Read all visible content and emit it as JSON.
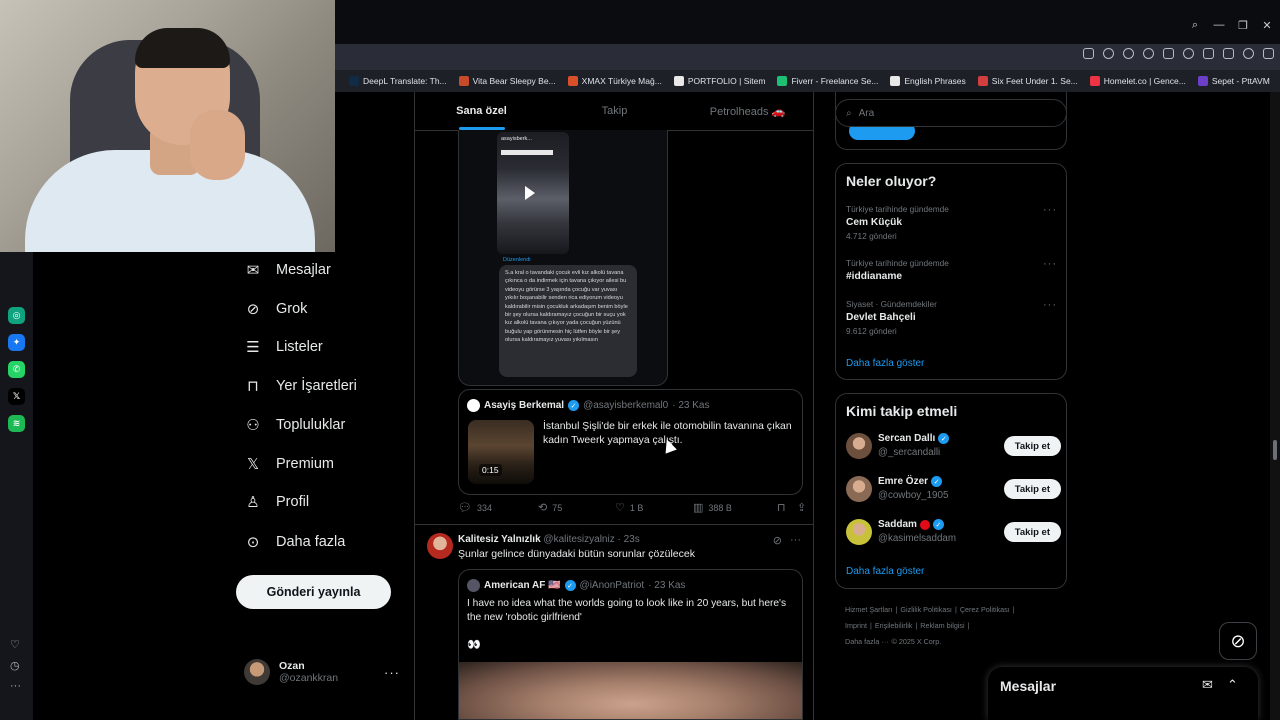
{
  "browser": {
    "bookmarks": [
      {
        "label": "DeepL Translate: Th...",
        "color": "#0f2b46"
      },
      {
        "label": "Vita Bear Sleepy Be...",
        "color": "#c74b2a"
      },
      {
        "label": "XMAX Türkiye Mağ...",
        "color": "#d8502a"
      },
      {
        "label": "PORTFOLIO | Sitem",
        "color": "#e8e8e8"
      },
      {
        "label": "Fiverr - Freelance Se...",
        "color": "#1dbf73"
      },
      {
        "label": "English Phrases",
        "color": "#e8e8e8"
      },
      {
        "label": "Six Feet Under 1. Se...",
        "color": "#d33f3f"
      },
      {
        "label": "Homelet.co | Gence...",
        "color": "#e34"
      },
      {
        "label": "Sepet - PttAVM",
        "color": "#6b3fc8"
      }
    ]
  },
  "appbar": {
    "apps": [
      {
        "name": "chatgpt-app-icon",
        "glyph": "◎",
        "color": "#10a37f"
      },
      {
        "name": "messenger-app-icon",
        "glyph": "✦",
        "color": "#1877f2"
      },
      {
        "name": "whatsapp-app-icon",
        "glyph": "✆",
        "color": "#25d366"
      },
      {
        "name": "x-app-icon",
        "glyph": "𝕏",
        "color": "#000000"
      },
      {
        "name": "spotify-app-icon",
        "glyph": "≋",
        "color": "#1db954"
      }
    ]
  },
  "nav": {
    "items": [
      {
        "label": "Mesajlar",
        "icon": "envelope-icon",
        "glyph": "✉"
      },
      {
        "label": "Grok",
        "icon": "grok-icon",
        "glyph": "⊘"
      },
      {
        "label": "Listeler",
        "icon": "list-icon",
        "glyph": "☰"
      },
      {
        "label": "Yer İşaretleri",
        "icon": "bookmark-icon",
        "glyph": "⊓"
      },
      {
        "label": "Topluluklar",
        "icon": "communities-icon",
        "glyph": "⚇"
      },
      {
        "label": "Premium",
        "icon": "x-logo-icon",
        "glyph": "𝕏"
      },
      {
        "label": "Profil",
        "icon": "profile-icon",
        "glyph": "♙"
      },
      {
        "label": "Daha fazla",
        "icon": "more-circle-icon",
        "glyph": "⊙"
      }
    ],
    "post_button": "Gönderi yayınla",
    "profile": {
      "name": "Ozan",
      "handle": "@ozankkran"
    }
  },
  "feed": {
    "tabs": [
      "Sana özel",
      "Takip",
      "Petrolheads 🚗"
    ],
    "screenshot": {
      "header": "asayisberk...",
      "link": "Düzenlendi",
      "dm_text": "S.a kral o tavandaki çocuk evli kız alkolü tavana çıkınca o da indirmek için tavana çıkıyor ailesi bu videoyu görürse 3 yaşında çocuğu var yuvası yıkılır boşanabilir senden rica ediyorum videoyu kaldırabilir misin çocukluk arkadaşım benim böyle bir şey olursa kaldıramayız çocuğun bir suçu yok kız alkolü tavana çıkıyor yada çocuğun yüzünü buğulu yap görünmesin hiç lütfen böyle bir şey olursa kaldıramayız yuvası yıkılmasın"
    },
    "quote1": {
      "name": "Asayiş Berkemal",
      "handle": "@asayisberkemal0",
      "date": "· 23 Kas",
      "text": "İstanbul Şişli'de bir erkek ile otomobilin tavanına çıkan kadın Tweerk yapmaya çalıştı.",
      "duration": "0:15"
    },
    "actions": {
      "replies": "334",
      "reposts": "75",
      "likes": "1 B",
      "views": "388 B"
    },
    "post2": {
      "name": "Kalitesiz Yalnızlık",
      "handle": "@kalitesizyalniz",
      "date": "· 23s",
      "text": "Şunlar gelince dünyadaki bütün sorunlar çözülecek"
    },
    "quote2": {
      "name": "American AF 🇺🇸",
      "handle": "@iAnonPatriot",
      "date": "· 23 Kas",
      "text": "I have no idea what the worlds going to look like in 20 years, but here's the new 'robotic girlfriend'",
      "emoji": "👀"
    }
  },
  "sidebar": {
    "search_placeholder": "Ara",
    "trends_title": "Neler oluyor?",
    "trends": [
      {
        "context": "Türkiye tarihinde gündemde",
        "title": "Cem Küçük",
        "count": "4.712 gönderi"
      },
      {
        "context": "Türkiye tarihinde gündemde",
        "title": "#iddianame",
        "count": ""
      },
      {
        "context": "Siyaset · Gündemdekiler",
        "title": "Devlet Bahçeli",
        "count": "9.612 gönderi"
      }
    ],
    "show_more": "Daha fazla göster",
    "who_title": "Kimi takip etmeli",
    "who": [
      {
        "name": "Sercan Dallı",
        "handle": "@_sercandalli",
        "flag": false,
        "avatar_color": "#6d4f3e"
      },
      {
        "name": "Emre Özer",
        "handle": "@cowboy_1905",
        "flag": false,
        "avatar_color": "#8a6a55"
      },
      {
        "name": "Saddam",
        "handle": "@kasimelsaddam",
        "flag": true,
        "avatar_color": "#c8c23a"
      }
    ],
    "follow_label": "Takip et",
    "footer": [
      "Hizmet Şartları",
      "|",
      "Gizlilik Politikası",
      "|",
      "Çerez Politikası",
      "|",
      "Imprint",
      "|",
      "Erişilebilirlik",
      "|",
      "Reklam bilgisi",
      "|",
      "Daha fazla ···",
      "© 2025 X Corp."
    ]
  },
  "drawer": {
    "title": "Mesajlar"
  }
}
